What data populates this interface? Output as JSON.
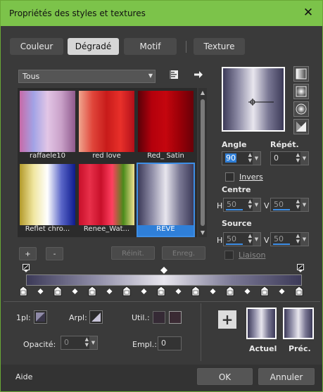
{
  "window": {
    "title": "Propriétés des styles et textures",
    "close": "✕"
  },
  "tabs": [
    "Couleur",
    "Dégradé",
    "Motif",
    "Texture"
  ],
  "category": {
    "value": "Tous"
  },
  "gradients": [
    {
      "label": "raffaele10",
      "stops": [
        "#c86aa8",
        "#a2a3e6",
        "#e2c6e6",
        "#c9a0c8",
        "#8e5a8c"
      ]
    },
    {
      "label": "red love",
      "stops": [
        "#f0a58e",
        "#e0453a",
        "#c81b1a",
        "#e8302a",
        "#b3101a"
      ]
    },
    {
      "label": "Red_ Satin",
      "stops": [
        "#5a0008",
        "#b4000c",
        "#c4060e",
        "#9a0008",
        "#6a0008"
      ]
    },
    {
      "label": "Reflet chro...",
      "stops": [
        "#b39a2a",
        "#f0e6a0",
        "#ffffff",
        "#5a66c8",
        "#0c1a8c"
      ]
    },
    {
      "label": "Renee_Wat...",
      "stops": [
        "#c8102a",
        "#e8304a",
        "#c8102a",
        "#ff4060",
        "#4a8a1a",
        "#f0e090"
      ]
    },
    {
      "label": "REVE",
      "stops": [
        "#3c3a58",
        "#8e8ca6",
        "#e8e6ee",
        "#7a7894",
        "#3c3a58"
      ],
      "selected": true
    }
  ],
  "buttons": {
    "plus": "+",
    "minus": "-",
    "reset": "Réinit.",
    "save": "Enreg."
  },
  "angle": {
    "label": "Angle",
    "value": "90"
  },
  "repeat": {
    "label": "Répét.",
    "value": "0"
  },
  "invert": {
    "label": "Invers"
  },
  "center": {
    "label": "Centre",
    "h_label": "H",
    "h": "50",
    "v_label": "V",
    "v": "50"
  },
  "source": {
    "label": "Source",
    "h_label": "H",
    "h": "50",
    "v_label": "V",
    "v": "50"
  },
  "link": {
    "label": "Liaison"
  },
  "bottom": {
    "onepl": "1pl:",
    "arpl": "Arpl:",
    "util": "Util.:",
    "opacity": "Opacité:",
    "opacity_value": "0",
    "empl": "Empl.:",
    "empl_value": "0",
    "current": "Actuel",
    "previous": "Préc.",
    "add": "+"
  },
  "footer": {
    "help": "Aide",
    "ok": "OK",
    "cancel": "Annuler"
  },
  "colors": {
    "accent": "#3d8ee6",
    "title_bg": "#7cc34a",
    "panel": "#3a3a3a"
  }
}
